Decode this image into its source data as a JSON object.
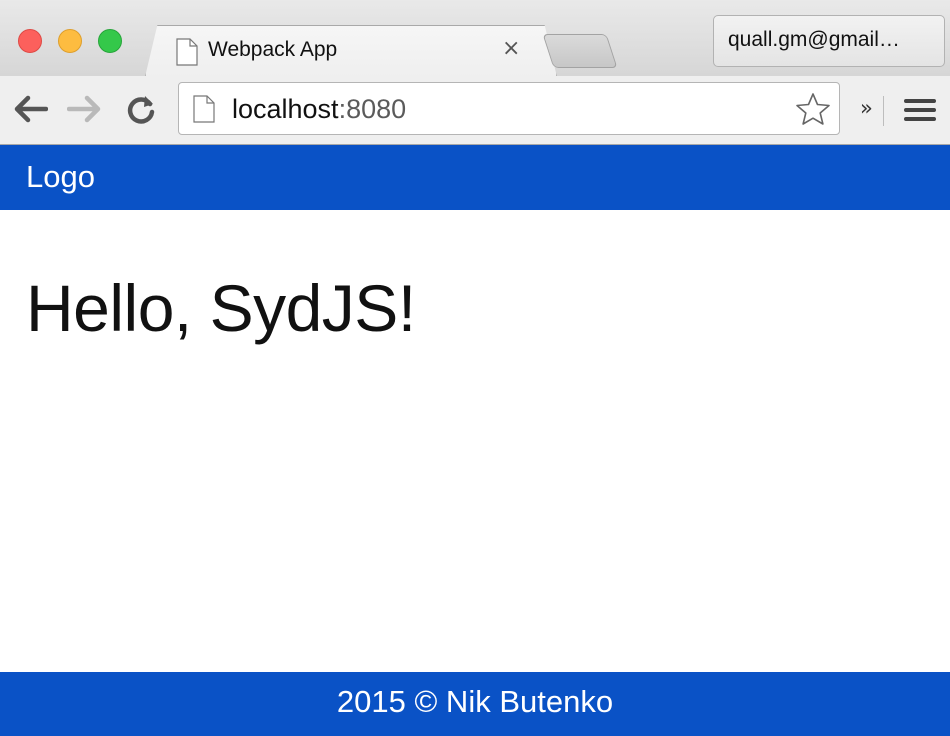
{
  "browser": {
    "tab_title": "Webpack App",
    "tab_close": "×",
    "profile": "quall.gm@gmail…",
    "url_host": "localhost",
    "url_port": ":8080",
    "extensions_chevron": "»",
    "icons": [
      "close-icon",
      "minimize-icon",
      "zoom-icon",
      "document-icon",
      "back-icon",
      "forward-icon",
      "reload-icon",
      "star-icon",
      "menu-icon"
    ]
  },
  "header": {
    "logo": "Logo"
  },
  "main": {
    "greeting": "Hello, SydJS!"
  },
  "footer": {
    "text": "2015 © Nik Butenko"
  },
  "colors": {
    "brand": "#0a52c6",
    "text": "#111111",
    "chrome": "#efefef"
  }
}
